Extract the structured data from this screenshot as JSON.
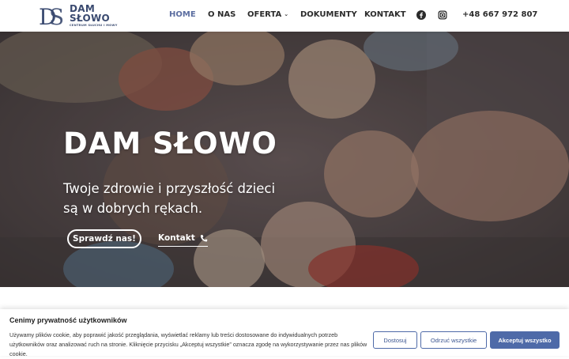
{
  "header": {
    "logo": {
      "line1": "DAM",
      "line2": "SŁOWO",
      "tagline": "CENTRUM SŁUCHU I MOWY",
      "monogram": "DS"
    },
    "nav": [
      {
        "label": "HOME",
        "active": true
      },
      {
        "label": "O NAS"
      },
      {
        "label": "OFERTA",
        "has_dropdown": true
      },
      {
        "label": "DOKUMENTY"
      },
      {
        "label": "KONTAKT"
      }
    ],
    "social": [
      "facebook-icon",
      "instagram-icon"
    ],
    "phone": "+48 667 972 807"
  },
  "hero": {
    "title": "DAM SŁOWO",
    "subtitle_line1": "Twoje zdrowie i przyszłość dzieci",
    "subtitle_line2": "są w dobrych rękach.",
    "primary_button": "Sprawdź nas!",
    "contact_link": "Kontakt",
    "contact_icon": "phone-icon"
  },
  "cookie": {
    "title": "Cenimy prywatność użytkowników",
    "text": "Używamy plików cookie, aby poprawić jakość przeglądania, wyświetlać reklamy lub treści dostosowane do indywidualnych potrzeb użytkowników oraz analizować ruch na stronie. Kliknięcie przycisku „Akceptuj wszystkie” oznacza zgodę na wykorzystywanie przez nas plików cookie.",
    "customize": "Dostosuj",
    "reject": "Odrzuć wszystkie",
    "accept": "Akceptuj wszystko"
  },
  "colors": {
    "brand": "#3a4a70",
    "accent": "#4e6aa8",
    "nav_active": "#5b6da0"
  }
}
